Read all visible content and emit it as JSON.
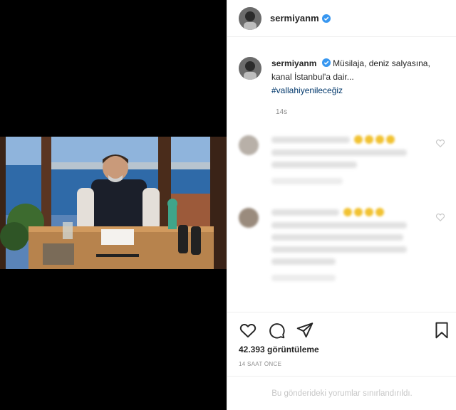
{
  "post": {
    "username": "sermiyanm",
    "verified": true,
    "caption_text": "Müsilaja, deniz salyasına, kanal İstanbul'a dair...",
    "hashtag": "#vallahiyenileceğiz",
    "age": "14s",
    "views": "42.393 görüntüleme",
    "posted_time": "14 SAAT ÖNCE",
    "comments_limited_notice": "Bu gönderideki yorumlar sınırlandırıldı."
  },
  "icons": {
    "like": "heart-icon",
    "comment": "comment-bubble-icon",
    "share": "paper-plane-icon",
    "save": "bookmark-icon",
    "verified": "verified-badge-icon"
  },
  "colors": {
    "verified_blue": "#3897f0",
    "hashtag_blue": "#00376b",
    "muted_gray": "#8e8e8e"
  }
}
